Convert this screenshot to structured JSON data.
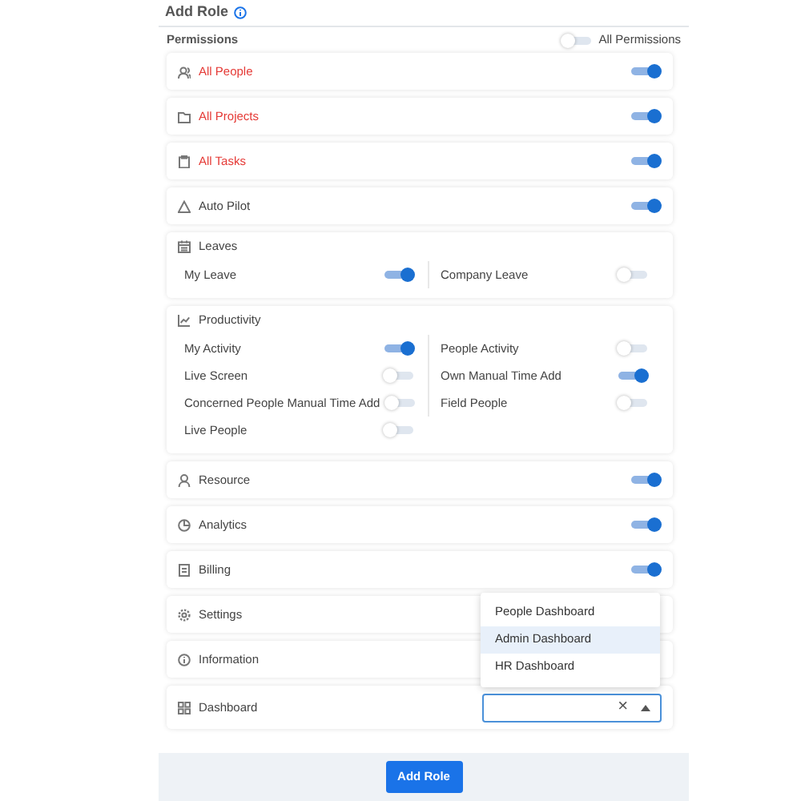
{
  "header": {
    "title": "Add Role"
  },
  "permissions": {
    "label": "Permissions",
    "all_label": "All Permissions",
    "all_on": false
  },
  "sections": [
    {
      "kind": "toggle",
      "label": "All People",
      "color": "#e53935",
      "on": true
    },
    {
      "kind": "toggle",
      "label": "All Projects",
      "color": "#e53935",
      "on": true
    },
    {
      "kind": "toggle",
      "label": "All Tasks",
      "color": "#e53935",
      "on": true
    },
    {
      "kind": "toggle",
      "label": "Auto Pilot",
      "color": "#444444",
      "on": true
    },
    {
      "kind": "group",
      "label": "Leaves",
      "color": "#444444",
      "items": [
        {
          "label": "My Leave",
          "on": true
        },
        {
          "label": "Company Leave",
          "on": false
        }
      ]
    },
    {
      "kind": "group",
      "label": "Productivity",
      "color": "#444444",
      "items": [
        {
          "label": "My Activity",
          "on": true
        },
        {
          "label": "People Activity",
          "on": false
        },
        {
          "label": "Live Screen",
          "on": false
        },
        {
          "label": "Own Manual Time Add",
          "on": true
        },
        {
          "label": "Concerned People Manual Time Add",
          "on": false
        },
        {
          "label": "Field People",
          "on": false
        },
        {
          "label": "Live People",
          "on": false
        }
      ]
    },
    {
      "kind": "toggle",
      "label": "Resource",
      "color": "#444444",
      "on": true
    },
    {
      "kind": "toggle",
      "label": "Analytics",
      "color": "#444444",
      "on": true
    },
    {
      "kind": "toggle",
      "label": "Billing",
      "color": "#444444",
      "on": true
    },
    {
      "kind": "plain",
      "label": "Settings",
      "color": "#444444"
    },
    {
      "kind": "plain",
      "label": "Information",
      "color": "#444444"
    },
    {
      "kind": "select",
      "label": "Dashboard",
      "color": "#444444",
      "clear": "×",
      "options": [
        {
          "label": "People Dashboard",
          "selected": false
        },
        {
          "label": "Admin Dashboard",
          "selected": true
        },
        {
          "label": "HR Dashboard",
          "selected": false
        }
      ]
    }
  ],
  "footer": {
    "button": "Add Role"
  }
}
